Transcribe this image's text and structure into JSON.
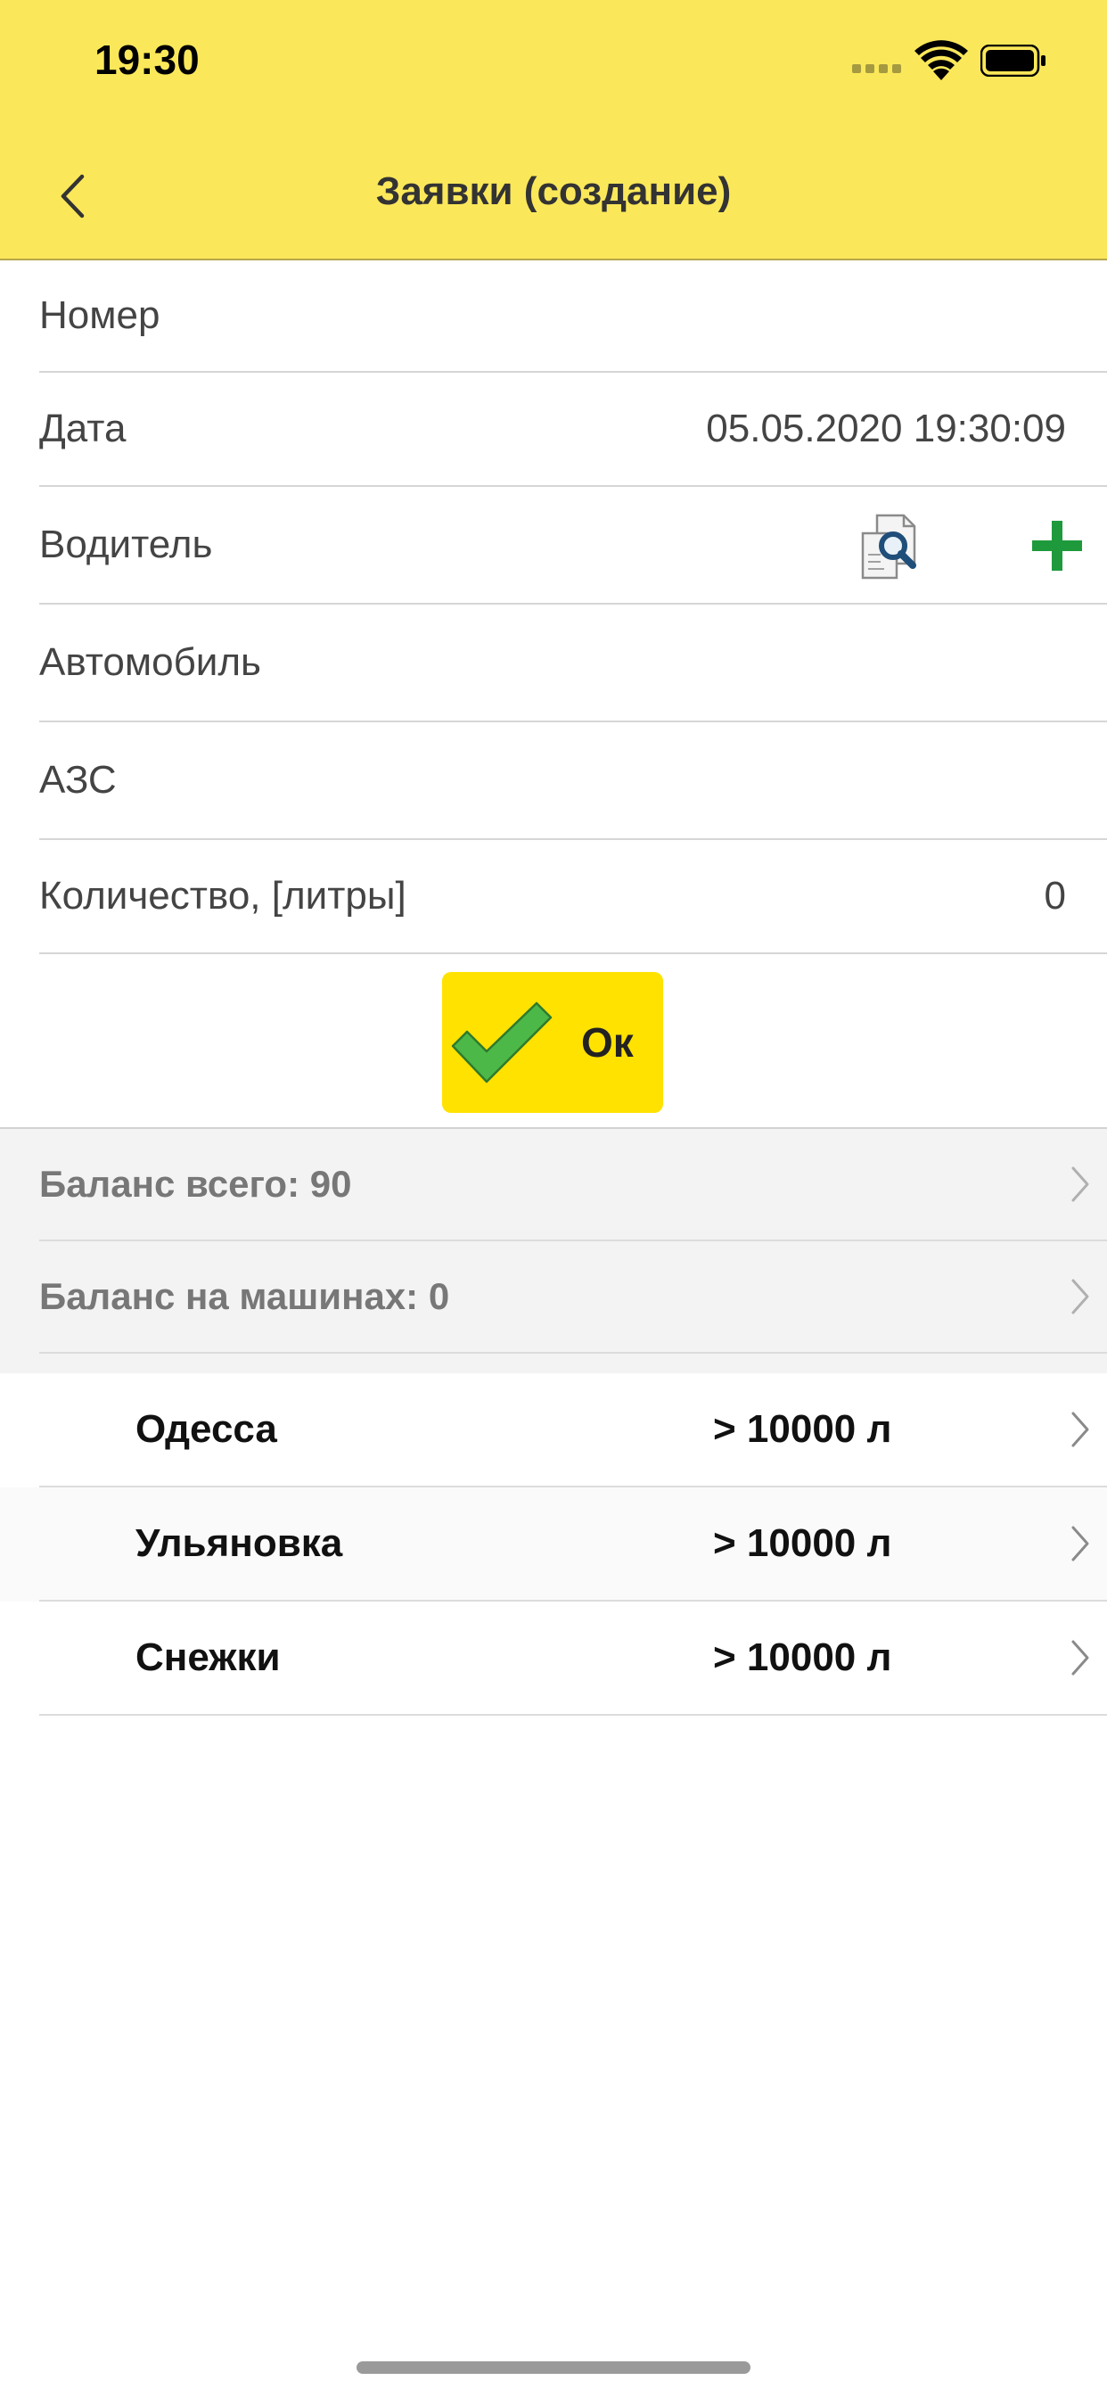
{
  "status_bar": {
    "time": "19:30"
  },
  "nav": {
    "title": "Заявки (создание)"
  },
  "form": {
    "number_label": "Номер",
    "date_label": "Дата",
    "date_value": "05.05.2020 19:30:09",
    "driver_label": "Водитель",
    "car_label": "Автомобиль",
    "station_label": "АЗС",
    "quantity_label": "Количество, [литры]",
    "quantity_value": "0"
  },
  "ok_button": {
    "label": "Ок"
  },
  "balances": {
    "total": "Баланс всего: 90",
    "on_cars": "Баланс на машинах: 0"
  },
  "stations": [
    {
      "name": "Одесса",
      "value": "> 10000 л"
    },
    {
      "name": "Ульяновка",
      "value": "> 10000 л"
    },
    {
      "name": "Снежки",
      "value": "> 10000 л"
    }
  ],
  "colors": {
    "header_bg": "#FBE85A",
    "ok_button_bg": "#FFE200",
    "check_green": "#4CB848",
    "plus_green": "#1E9A3C",
    "find_blue": "#1F4E7A"
  },
  "icons": [
    "signal-icon",
    "wifi-icon",
    "battery-icon",
    "back-chevron-icon",
    "find-document-icon",
    "plus-icon",
    "checkmark-icon",
    "chevron-right-icon"
  ]
}
